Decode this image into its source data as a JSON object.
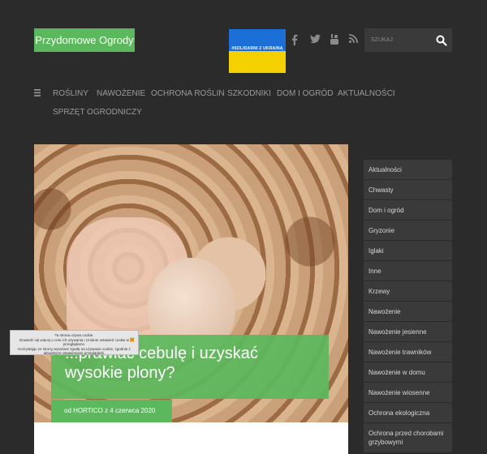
{
  "site": {
    "title": "Przydomowe Ogrody"
  },
  "banner": {
    "text": "#SOLIDARNI Z UKRAINĄ",
    "colors": [
      "#1d6fd8",
      "#f5d000"
    ]
  },
  "social": {
    "icons": [
      "facebook-icon",
      "twitter-icon",
      "youtube-icon",
      "rss-icon"
    ]
  },
  "search": {
    "placeholder": "SZUKAJ"
  },
  "nav": {
    "items": [
      "ROŚLINY",
      "NAWOŻENIE",
      "OCHRONA ROŚLIN",
      "SZKODNIKI",
      "DOM I OGRÓD",
      "AKTUALNOŚCI",
      "SPRZĘT OGRODNICZY"
    ]
  },
  "article": {
    "title": "Jak sprawiać cebulę i uzyskać wysokie plony?",
    "title_visible": "...prawiać cebulę i uzyskać wysokie plony?",
    "meta": "od HORTICO z 4 czerwca 2020"
  },
  "sidebar": {
    "categories": [
      "Aktualności",
      "Chwasty",
      "Dom i ogród",
      "Gryzonie",
      "Iglaki",
      "Inne",
      "Krzewy",
      "Nawożenie",
      "Nawożenie jesienne",
      "Nawożenie trawników",
      "Nawożenie w domu",
      "Nawożenie wiosenne",
      "Ochrona ekologiczna",
      "Ochrona przed chorobami grzybowymi"
    ]
  },
  "cookie": {
    "line1": "Ta strona używa cookie.",
    "line2": "Dowiedz się więcej o celu ich używania i zmianie ustawień cookie w przeglądarce.",
    "line3": "Korzystając ze strony wyrażasz zgodę na używanie cookie, zgodnie z aktualnymi ustawieniami przeglądarki.",
    "close": "✖"
  },
  "colors": {
    "accent": "#5cb85c",
    "background": "#2b2b2b",
    "sidebar_item": "#3a3a3a"
  }
}
